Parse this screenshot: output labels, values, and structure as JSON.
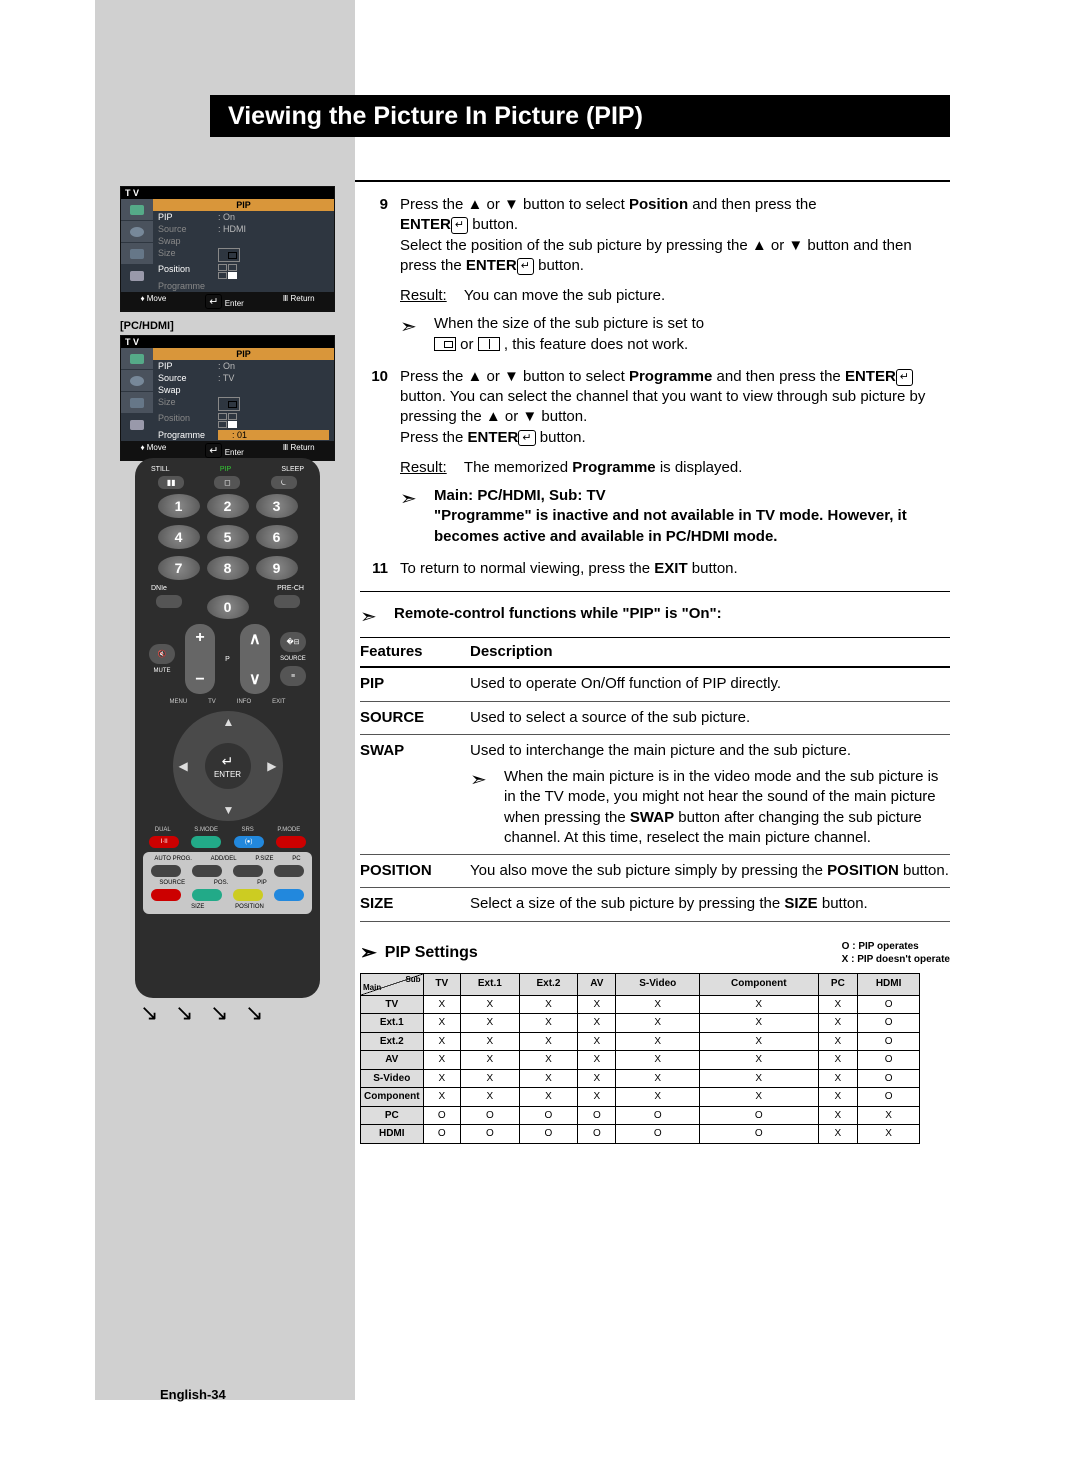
{
  "title": "Viewing the Picture In Picture (PIP)",
  "osd": {
    "label_pchdmi": "[PC/HDMI]",
    "tv": "T V",
    "menu_title": "PIP",
    "items1": [
      {
        "k": "PIP",
        "v": ": On"
      },
      {
        "k": "Source",
        "v": ": HDMI"
      },
      {
        "k": "Swap",
        "v": ""
      },
      {
        "k": "Size",
        "v": ":"
      },
      {
        "k": "Position",
        "v": ":"
      },
      {
        "k": "Programme",
        "v": ":"
      }
    ],
    "items2": [
      {
        "k": "PIP",
        "v": ": On"
      },
      {
        "k": "Source",
        "v": ": TV"
      },
      {
        "k": "Swap",
        "v": ""
      },
      {
        "k": "Size",
        "v": ":"
      },
      {
        "k": "Position",
        "v": ":"
      },
      {
        "k": "Programme",
        "v": ": 01"
      }
    ],
    "foot_move": "Move",
    "foot_enter": "Enter",
    "foot_return": "Return"
  },
  "remote": {
    "top_labels": [
      "STILL",
      "PIP",
      "SLEEP"
    ],
    "dnie": "DNIe",
    "prech": "PRE-CH",
    "zero": "0",
    "mute": "MUTE",
    "source": "SOURCE",
    "p": "P",
    "tv": "TV",
    "info": "INFO",
    "menu": "MENU",
    "exit": "EXIT",
    "enter": "ENTER",
    "row_labels": [
      "DUAL",
      "S.MODE",
      "SRS",
      "P.MODE"
    ],
    "row_colors": [
      "#c00",
      "#2a8",
      "#28d",
      "#c00"
    ],
    "row_text": [
      "I·II",
      "",
      "(●)",
      ""
    ],
    "row2_labels": [
      "AUTO PROG.",
      "ADD/DEL",
      "P.SIZE",
      "PC"
    ],
    "row3_labels": [
      "SOURCE",
      "SIZE",
      "POSITION",
      ""
    ],
    "row3_up": [
      "",
      "POS.",
      "PIP",
      ""
    ],
    "bottom_colors": [
      "#c00",
      "#2a8",
      "#cc2",
      "#28d"
    ]
  },
  "steps": {
    "s9": {
      "num": "9",
      "l1a": "Press the ▲ or ▼ button to select ",
      "l1b": "Position",
      "l1c": " and then press the ",
      "l2a": "ENTER",
      "l2b": " button.",
      "l3": "Select the position of the sub picture by pressing the ▲ or ▼ button and then press the ",
      "l3b": "ENTER",
      "l3c": " button.",
      "result_lbl": "Result:",
      "result": "You can move the sub picture.",
      "note": "When the size of the sub picture is set to ",
      "note2": " or ",
      "note3": " , this feature does not work."
    },
    "s10": {
      "num": "10",
      "l1a": "Press the ▲ or ▼ button to select ",
      "l1b": "Programme",
      "l1c": " and then press the ",
      "l2a": "ENTER",
      "l2b": " button. You can select the channel that you want to view through sub picture by pressing the ▲ or ▼ button.",
      "l3": "Press the ",
      "l3b": "ENTER",
      "l3c": " button.",
      "result_lbl": "Result:",
      "result_a": "The memorized ",
      "result_b": "Programme",
      "result_c": " is displayed.",
      "note1": "Main: PC/HDMI, Sub: TV",
      "note2": "\"Programme\" is inactive and not available in TV mode. However, it becomes active and available in PC/HDMI mode."
    },
    "s11": {
      "num": "11",
      "t1": "To return to normal viewing, press the ",
      "t2": "EXIT",
      "t3": " button."
    }
  },
  "rcnote": "Remote-control functions while \"PIP\" is \"On\":",
  "ftable": {
    "h1": "Features",
    "h2": "Description",
    "rows": [
      {
        "f": "PIP",
        "d": "Used to operate On/Off function of PIP directly."
      },
      {
        "f": "SOURCE",
        "d": "Used to select a source of the sub picture."
      },
      {
        "f": "SWAP",
        "d": "Used to interchange the main picture and the sub picture.",
        "note": "When the main picture is in the video mode and the sub picture is in the TV mode, you might not hear the sound of the main picture when pressing the ",
        "noteb": "SWAP",
        "note2": " button after changing the sub picture channel. At this time, reselect the main picture channel."
      },
      {
        "f": "POSITION",
        "d1": "You also move the sub picture simply by pressing the ",
        "d2": "POSITION",
        "d3": " button."
      },
      {
        "f": "SIZE",
        "d1": "Select a size of the sub picture by pressing the ",
        "d2": "SIZE",
        "d3": " button."
      }
    ]
  },
  "settings": {
    "title": "PIP Settings",
    "legend_o": "O :   PIP operates",
    "legend_x": "X :   PIP doesn't operate",
    "cols": [
      "TV",
      "Ext.1",
      "Ext.2",
      "AV",
      "S-Video",
      "Component",
      "PC",
      "HDMI"
    ],
    "corner_sub": "Sub",
    "corner_main": "Main",
    "rows": [
      {
        "h": "TV",
        "v": [
          "X",
          "X",
          "X",
          "X",
          "X",
          "X",
          "X",
          "O"
        ]
      },
      {
        "h": "Ext.1",
        "v": [
          "X",
          "X",
          "X",
          "X",
          "X",
          "X",
          "X",
          "O"
        ]
      },
      {
        "h": "Ext.2",
        "v": [
          "X",
          "X",
          "X",
          "X",
          "X",
          "X",
          "X",
          "O"
        ]
      },
      {
        "h": "AV",
        "v": [
          "X",
          "X",
          "X",
          "X",
          "X",
          "X",
          "X",
          "O"
        ]
      },
      {
        "h": "S-Video",
        "v": [
          "X",
          "X",
          "X",
          "X",
          "X",
          "X",
          "X",
          "O"
        ]
      },
      {
        "h": "Component",
        "v": [
          "X",
          "X",
          "X",
          "X",
          "X",
          "X",
          "X",
          "O"
        ]
      },
      {
        "h": "PC",
        "v": [
          "O",
          "O",
          "O",
          "O",
          "O",
          "O",
          "X",
          "X"
        ]
      },
      {
        "h": "HDMI",
        "v": [
          "O",
          "O",
          "O",
          "O",
          "O",
          "O",
          "X",
          "X"
        ]
      }
    ]
  },
  "pagenum": "English-34"
}
